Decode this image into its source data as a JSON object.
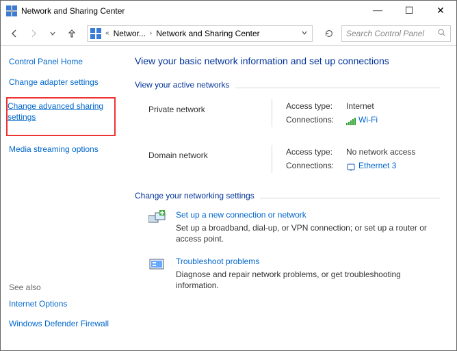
{
  "window": {
    "title": "Network and Sharing Center"
  },
  "toolbar": {
    "breadcrumb_networ": "Networ...",
    "breadcrumb_current": "Network and Sharing Center",
    "search_placeholder": "Search Control Panel"
  },
  "sidebar": {
    "home": "Control Panel Home",
    "adapter": "Change adapter settings",
    "adv_sharing": "Change advanced sharing settings",
    "streaming": "Media streaming options",
    "see_also": "See also",
    "internet_options": "Internet Options",
    "firewall": "Windows Defender Firewall"
  },
  "main": {
    "page_title": "View your basic network information and set up connections",
    "active_heading": "View your active networks",
    "net1": {
      "name": "Private network",
      "access_label": "Access type:",
      "access_val": "Internet",
      "conn_label": "Connections:",
      "conn_val": "Wi-Fi"
    },
    "net2": {
      "name": "Domain network",
      "access_label": "Access type:",
      "access_val": "No network access",
      "conn_label": "Connections:",
      "conn_val": "Ethernet 3"
    },
    "change_heading": "Change your networking settings",
    "task1": {
      "title": "Set up a new connection or network",
      "desc": "Set up a broadband, dial-up, or VPN connection; or set up a router or access point."
    },
    "task2": {
      "title": "Troubleshoot problems",
      "desc": "Diagnose and repair network problems, or get troubleshooting information."
    }
  }
}
